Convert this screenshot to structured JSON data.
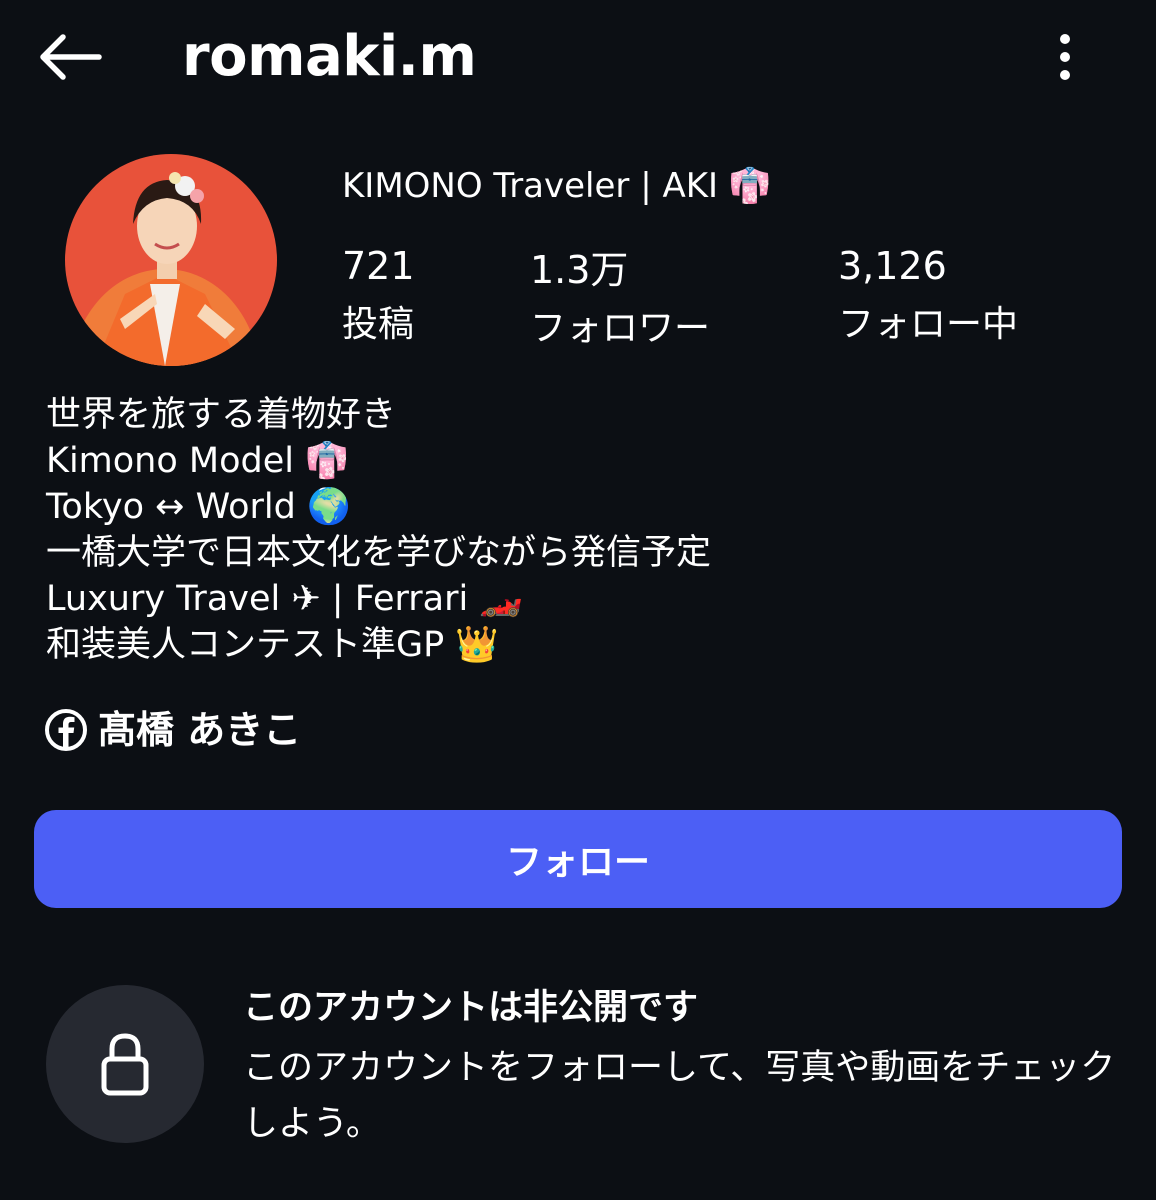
{
  "header": {
    "username": "romaki.m"
  },
  "profile": {
    "display_name": "KIMONO Traveler | AKI 👘",
    "stats": [
      {
        "value": "721",
        "label": "投稿"
      },
      {
        "value": "1.3万",
        "label": "フォロワー"
      },
      {
        "value": "3,126",
        "label": "フォロー中"
      }
    ]
  },
  "bio": {
    "lines": [
      "世界を旅する着物好き",
      "Kimono Model 👘",
      "Tokyo ↔ World 🌍",
      "一橋大学で日本文化を学びながら発信予定",
      "Luxury Travel ✈ | Ferrari 🏎️",
      "和装美人コンテスト準GP 👑"
    ]
  },
  "facebook_link": {
    "name": "髙橋 あきこ"
  },
  "follow_button": {
    "label": "フォロー"
  },
  "private_notice": {
    "title": "このアカウントは非公開です",
    "description": "このアカウントをフォローして、写真や動画をチェックしよう。"
  },
  "colors": {
    "background": "#0c0f14",
    "follow_button": "#4c5ff5",
    "lock_circle": "#262931",
    "avatar_background": "#e8523a"
  }
}
